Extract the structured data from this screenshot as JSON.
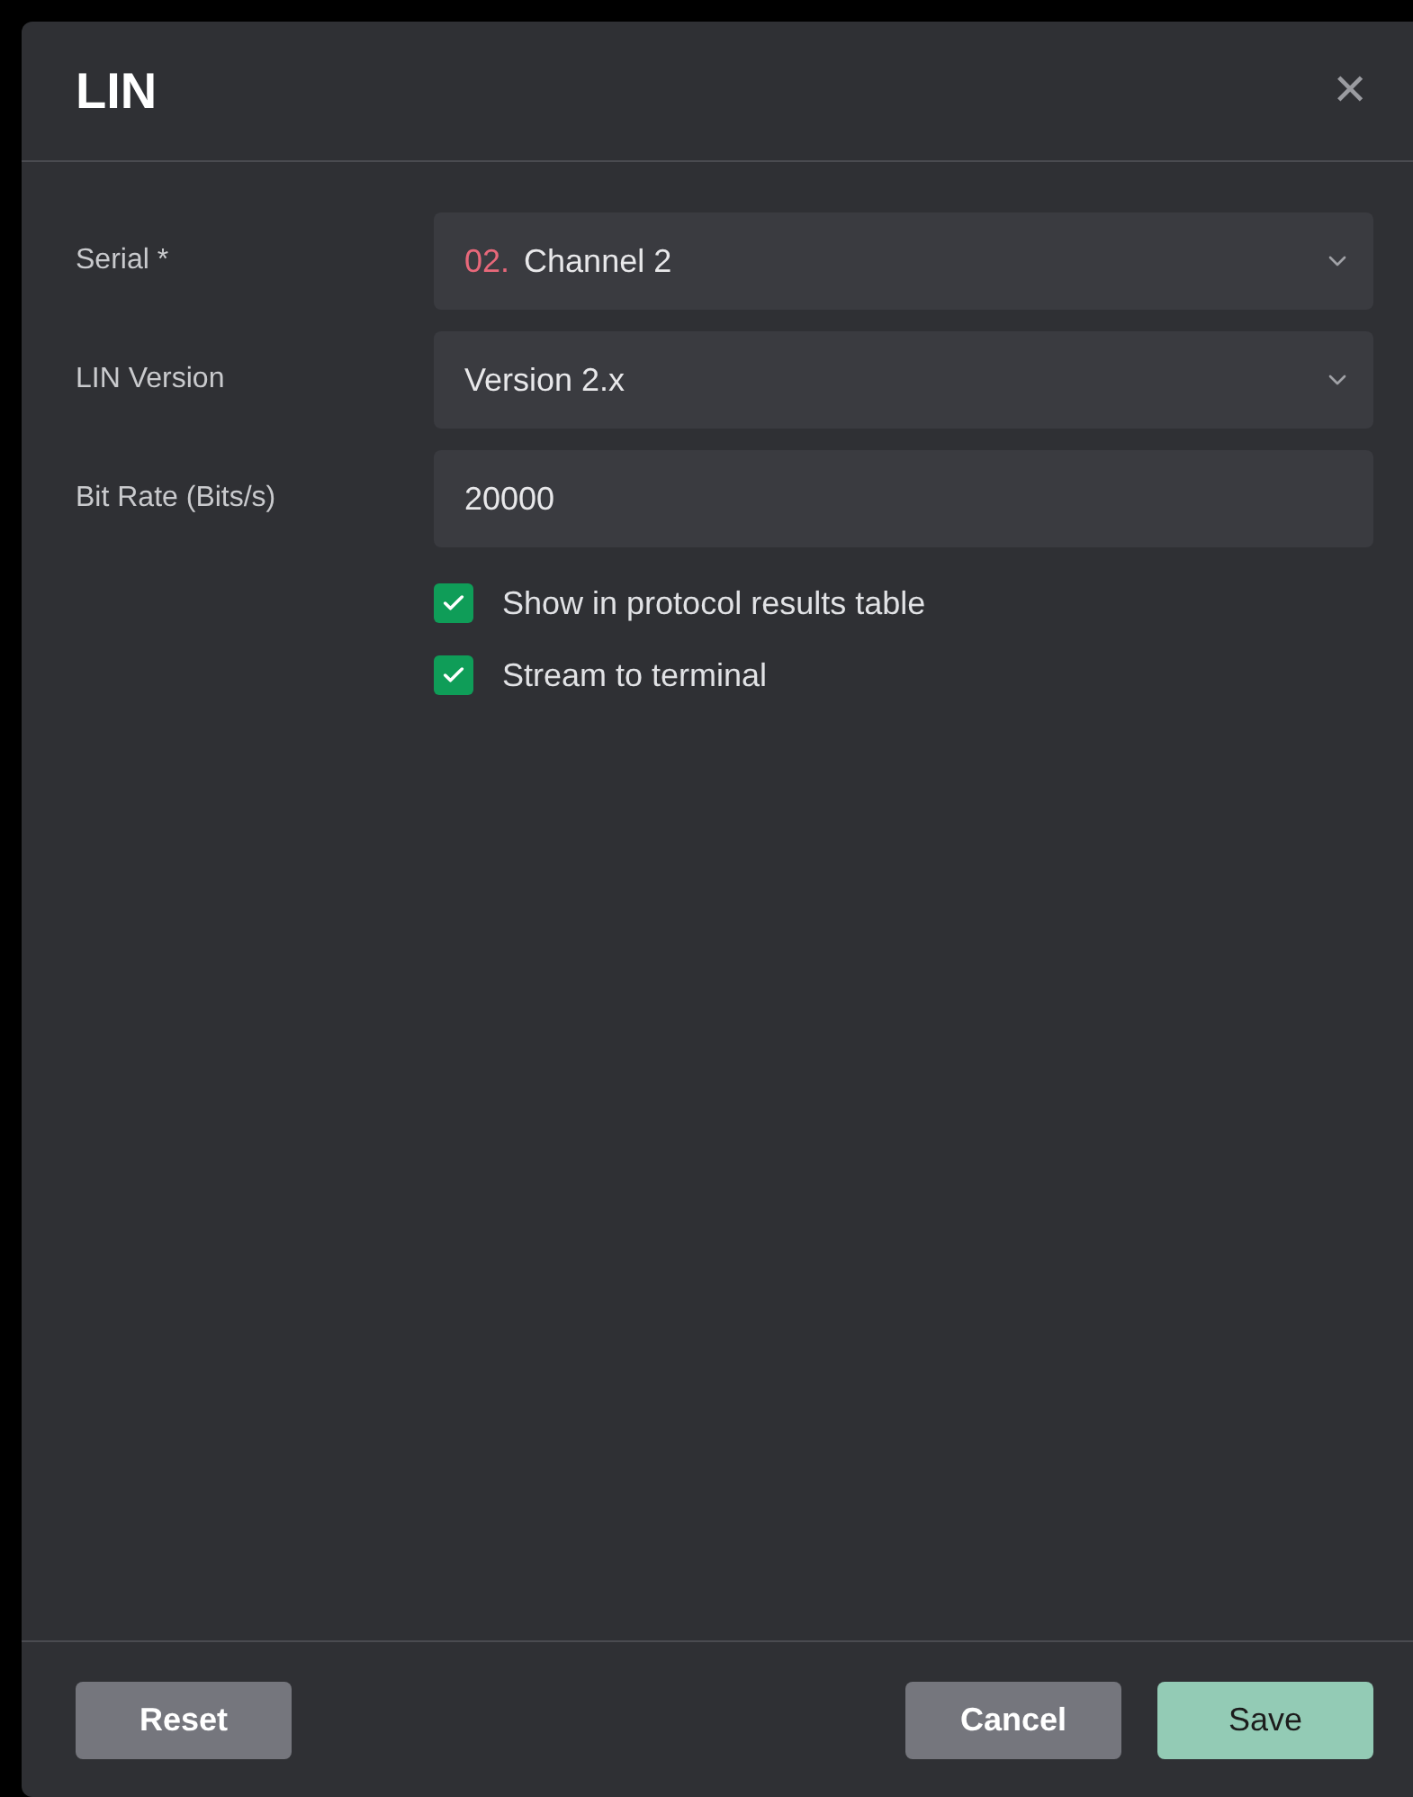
{
  "dialog": {
    "title": "LIN",
    "close_label": "✕"
  },
  "fields": [
    {
      "kind": "select",
      "label": "Serial *",
      "prefix": "02.",
      "value": "Channel 2"
    },
    {
      "kind": "select",
      "label": "LIN Version",
      "value": "Version 2.x"
    },
    {
      "kind": "input",
      "label": "Bit Rate (Bits/s)",
      "value": "20000"
    }
  ],
  "options": [
    {
      "label": "Show in protocol results table",
      "checked": true
    },
    {
      "label": "Stream to terminal",
      "checked": true
    }
  ],
  "footer": {
    "left": [
      {
        "label": "Reset",
        "kind": "secondary"
      }
    ],
    "right": [
      {
        "label": "Cancel",
        "kind": "secondary"
      },
      {
        "label": "Save",
        "kind": "primary"
      }
    ]
  }
}
